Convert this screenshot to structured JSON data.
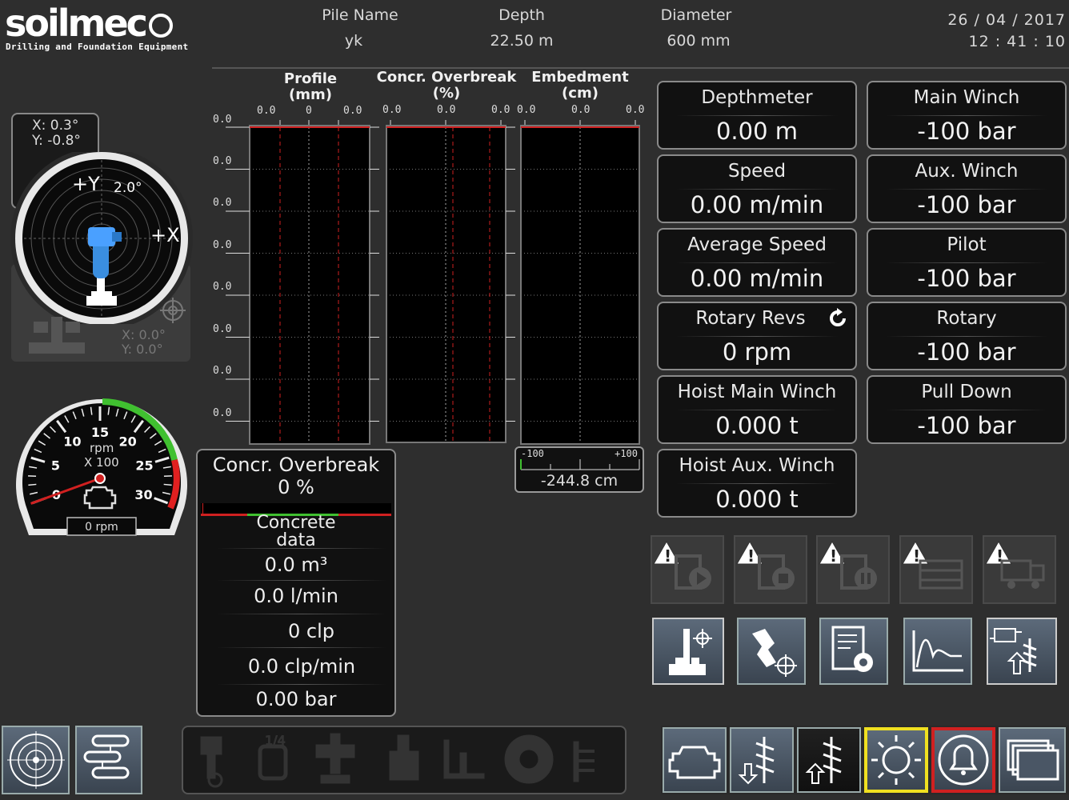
{
  "header": {
    "logo_text": "soilmec",
    "logo_tagline": "Drilling and Foundation Equipment",
    "pile_name_label": "Pile Name",
    "pile_name_value": "yk",
    "depth_label": "Depth",
    "depth_value": "22.50 m",
    "diameter_label": "Diameter",
    "diameter_value": "600 mm",
    "date": "26  / 04  / 2017",
    "time": "12  : 41  : 10"
  },
  "inclinometer": {
    "x_reading": "X: 0.3°",
    "y_reading": "Y: -0.8°",
    "plus_y": "+Y",
    "plus_x": "+X",
    "range": "2.0°",
    "secondary_x": "X: 0.0°",
    "secondary_y": "Y: 0.0°"
  },
  "tachometer": {
    "ticks": [
      "0",
      "5",
      "10",
      "15",
      "20",
      "25",
      "30"
    ],
    "unit": "rpm",
    "multiplier": "X 100",
    "readout": "0 rpm",
    "value": 0
  },
  "profile_chart": {
    "columns": [
      {
        "title": "Profile",
        "unit": "(mm)",
        "ticks": [
          "0.0",
          "0",
          "0.0"
        ]
      },
      {
        "title": "Concr. Overbreak",
        "unit": "(%)",
        "ticks": [
          "0.0",
          "0.0",
          "0.0"
        ]
      },
      {
        "title": "Embedment",
        "unit": "(cm)",
        "ticks": [
          "0.0",
          "0.0",
          "0.0"
        ]
      }
    ],
    "row_labels": [
      "0.0",
      "0.0",
      "0.0",
      "0.0",
      "0.0",
      "0.0",
      "0.0",
      "0.0"
    ],
    "embed_scale_min": "-100",
    "embed_scale_max": "+100",
    "embed_value": "-244.8 cm"
  },
  "concrete": {
    "overbreak_label": "Concr. Overbreak",
    "overbreak_value": "0 %",
    "data_label_1": "Concrete",
    "data_label_2": "data",
    "volume": "0.0 m³",
    "flow": "0.0 l/min",
    "clp": "0 clp",
    "clp_rate": "0.0 clp/min",
    "pressure": "0.00 bar"
  },
  "left_panels": [
    {
      "title": "Depthmeter",
      "value": "0.00 m"
    },
    {
      "title": "Speed",
      "value": "0.00 m/min"
    },
    {
      "title": "Average Speed",
      "value": "0.00 m/min"
    },
    {
      "title": "Rotary Revs",
      "value": "0 rpm"
    },
    {
      "title": "Hoist Main Winch",
      "value": "0.000 t"
    },
    {
      "title": "Hoist Aux. Winch",
      "value": "0.000 t"
    }
  ],
  "right_panels": [
    {
      "title": "Main Winch",
      "value": "-100 bar"
    },
    {
      "title": "Aux. Winch",
      "value": "-100 bar"
    },
    {
      "title": "Pilot",
      "value": "-100 bar"
    },
    {
      "title": "Rotary",
      "value": "-100 bar"
    },
    {
      "title": "Pull Down",
      "value": "-100 bar"
    }
  ],
  "tool_icons": {
    "disabled": [
      "warning-start-icon",
      "warning-stop-icon",
      "warning-pause-icon",
      "warning-table-icon",
      "warning-truck-icon"
    ],
    "active": [
      "mast-icon",
      "drill-target-icon",
      "report-settings-icon",
      "graph-icon",
      "auger-swap-icon"
    ]
  },
  "bottom_bar": {
    "left": [
      "target-icon",
      "menu-list-icon"
    ],
    "disabled_tray": [
      "piston-icon",
      "winch-quarter-icon",
      "clamp-icon",
      "pump-icon",
      "tower-icon",
      "circle-icon",
      "ladder-icon"
    ],
    "disabled_tray_label": "1/4",
    "right": [
      "engine-icon",
      "auger-down-icon",
      "auger-up-icon",
      "light-icon",
      "alarm-bell-icon",
      "windows-icon"
    ]
  },
  "colors": {
    "background": "#2e2e2e",
    "panel": "#111111",
    "highlight_yellow": "#f0e020",
    "highlight_red": "#d02020",
    "gauge_green": "#40c030",
    "gauge_red": "#e02020"
  }
}
